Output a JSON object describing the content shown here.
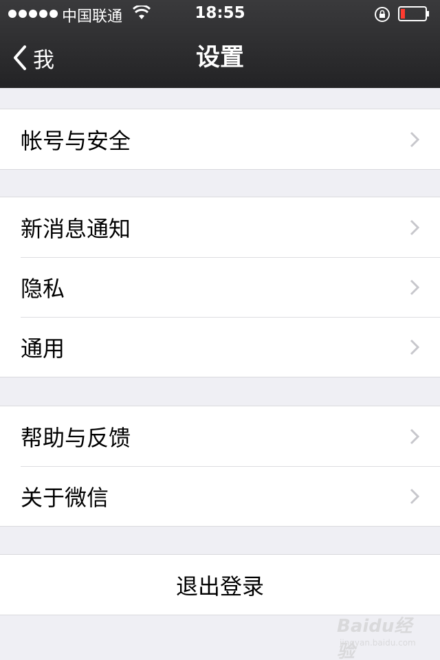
{
  "status_bar": {
    "carrier": "中国联通",
    "time": "18:55"
  },
  "nav": {
    "back_label": "我",
    "title": "设置"
  },
  "groups": [
    {
      "items": [
        {
          "label": "帐号与安全"
        }
      ]
    },
    {
      "items": [
        {
          "label": "新消息通知"
        },
        {
          "label": "隐私"
        },
        {
          "label": "通用"
        }
      ]
    },
    {
      "items": [
        {
          "label": "帮助与反馈"
        },
        {
          "label": "关于微信"
        }
      ]
    }
  ],
  "logout": {
    "label": "退出登录"
  },
  "watermark": {
    "text": "Baidu经验",
    "sub": "jingyan.baidu.com"
  },
  "colors": {
    "nav_bg": "#2c2c2e",
    "page_bg": "#efeff4",
    "battery_low": "#ff3b30"
  }
}
